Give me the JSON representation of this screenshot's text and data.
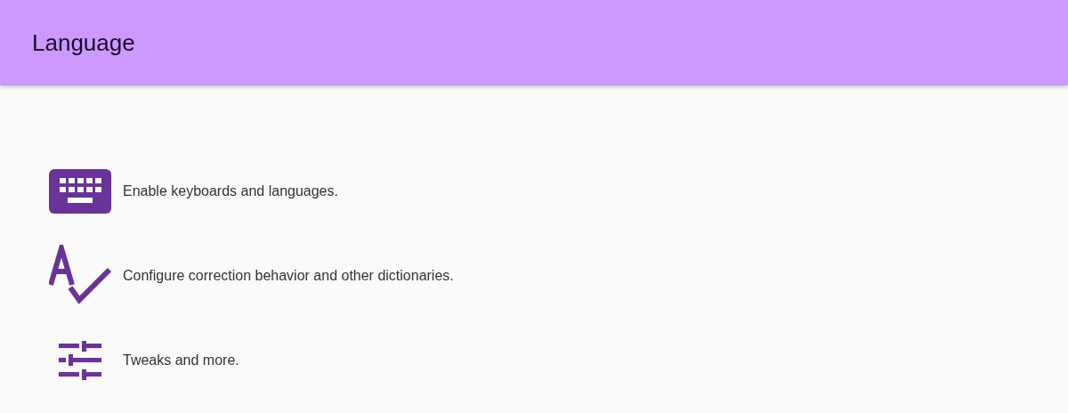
{
  "app_bar": {
    "title": "Language"
  },
  "items": [
    {
      "kind": "keyboard",
      "label": "Enable keyboards and languages."
    },
    {
      "kind": "spellcheck",
      "label": "Configure correction behavior and other dictionaries."
    },
    {
      "kind": "tune",
      "label": "Tweaks and more."
    }
  ]
}
